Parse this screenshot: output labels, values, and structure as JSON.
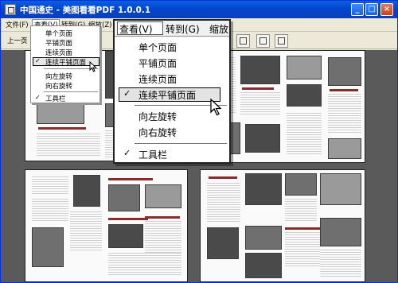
{
  "window": {
    "title": "中国通史 - 美图看看PDF 1.0.0.1",
    "minimize": "_",
    "maximize": "□",
    "close": "×"
  },
  "menubar": {
    "file": "文件(F)",
    "view": "查看(V)",
    "goto": "转到(G)",
    "zoom": "缩放(Z)"
  },
  "toolbar": {
    "prev_page": "上一页"
  },
  "view_menu_small": {
    "items": [
      "单个页面",
      "平铺页面",
      "连续页面",
      "连续平铺页面",
      "向左旋转",
      "向右旋转",
      "工具栏"
    ],
    "check": "✓"
  },
  "view_menu_zoomed": {
    "bar_view": "查看(V)",
    "bar_goto": "转到(G)",
    "bar_zoom": "缩放",
    "items": [
      "单个页面",
      "平铺页面",
      "连续页面",
      "连续平铺页面",
      "向左旋转",
      "向右旋转",
      "工具栏"
    ],
    "check": "✓"
  },
  "colors": {
    "titlebar": "#0346d0",
    "chrome": "#ece9d8",
    "document_bg": "#5a5a5a",
    "heading_red": "#8a2b2b"
  }
}
